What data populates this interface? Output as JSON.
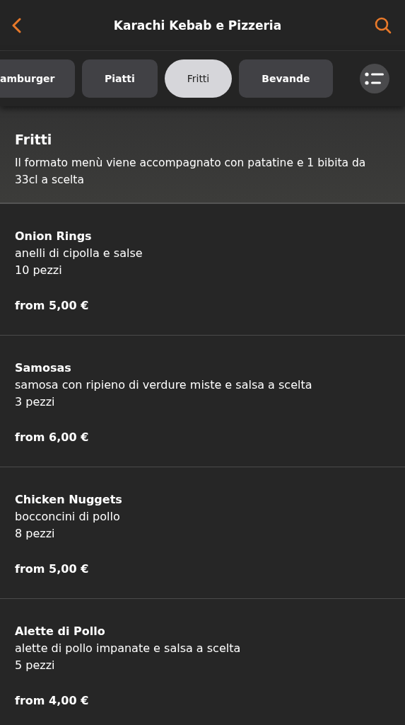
{
  "header": {
    "title": "Karachi Kebab e Pizzeria"
  },
  "tabs": [
    {
      "label": "amburger",
      "selected": false
    },
    {
      "label": "Piatti",
      "selected": false
    },
    {
      "label": "Fritti",
      "selected": true
    },
    {
      "label": "Bevande",
      "selected": false
    }
  ],
  "section": {
    "title": "Fritti",
    "description": "Il formato menù viene accompagnato con patatine e 1 bibita da 33cl a scelta"
  },
  "items": [
    {
      "name": "Onion Rings",
      "description": "anelli di cipolla e salse",
      "quantity": "10 pezzi",
      "price": "from 5,00 €"
    },
    {
      "name": "Samosas",
      "description": "samosa con ripieno di verdure miste e salsa a scelta",
      "quantity": "3 pezzi",
      "price": "from 6,00 €"
    },
    {
      "name": "Chicken Nuggets",
      "description": "bocconcini di pollo",
      "quantity": "8 pezzi",
      "price": "from 5,00 €"
    },
    {
      "name": "Alette di Pollo",
      "description": "alette di pollo impanate e salsa a scelta",
      "quantity": "5 pezzi",
      "price": "from 4,00 €"
    }
  ]
}
